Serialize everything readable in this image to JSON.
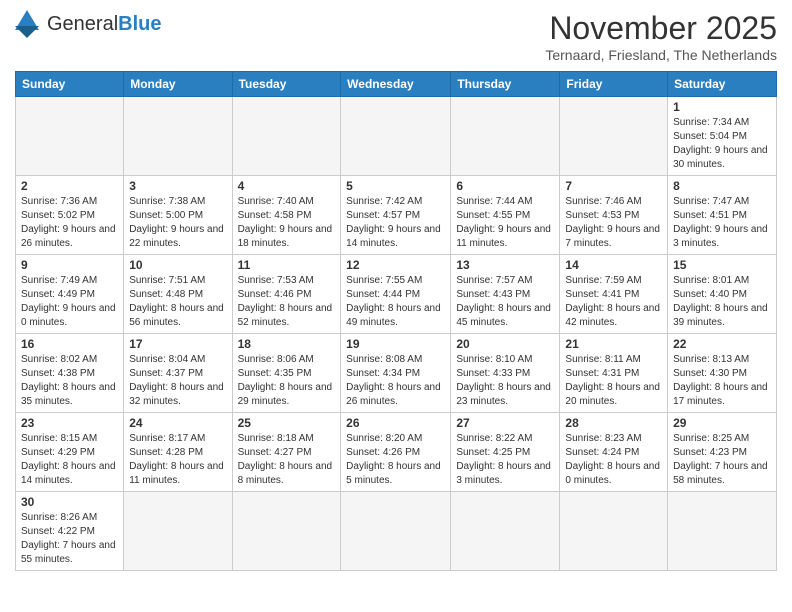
{
  "logo": {
    "text_general": "General",
    "text_blue": "Blue"
  },
  "title": "November 2025",
  "subtitle": "Ternaard, Friesland, The Netherlands",
  "weekdays": [
    "Sunday",
    "Monday",
    "Tuesday",
    "Wednesday",
    "Thursday",
    "Friday",
    "Saturday"
  ],
  "weeks": [
    [
      {
        "day": "",
        "info": ""
      },
      {
        "day": "",
        "info": ""
      },
      {
        "day": "",
        "info": ""
      },
      {
        "day": "",
        "info": ""
      },
      {
        "day": "",
        "info": ""
      },
      {
        "day": "",
        "info": ""
      },
      {
        "day": "1",
        "info": "Sunrise: 7:34 AM\nSunset: 5:04 PM\nDaylight: 9 hours and 30 minutes."
      }
    ],
    [
      {
        "day": "2",
        "info": "Sunrise: 7:36 AM\nSunset: 5:02 PM\nDaylight: 9 hours and 26 minutes."
      },
      {
        "day": "3",
        "info": "Sunrise: 7:38 AM\nSunset: 5:00 PM\nDaylight: 9 hours and 22 minutes."
      },
      {
        "day": "4",
        "info": "Sunrise: 7:40 AM\nSunset: 4:58 PM\nDaylight: 9 hours and 18 minutes."
      },
      {
        "day": "5",
        "info": "Sunrise: 7:42 AM\nSunset: 4:57 PM\nDaylight: 9 hours and 14 minutes."
      },
      {
        "day": "6",
        "info": "Sunrise: 7:44 AM\nSunset: 4:55 PM\nDaylight: 9 hours and 11 minutes."
      },
      {
        "day": "7",
        "info": "Sunrise: 7:46 AM\nSunset: 4:53 PM\nDaylight: 9 hours and 7 minutes."
      },
      {
        "day": "8",
        "info": "Sunrise: 7:47 AM\nSunset: 4:51 PM\nDaylight: 9 hours and 3 minutes."
      }
    ],
    [
      {
        "day": "9",
        "info": "Sunrise: 7:49 AM\nSunset: 4:49 PM\nDaylight: 9 hours and 0 minutes."
      },
      {
        "day": "10",
        "info": "Sunrise: 7:51 AM\nSunset: 4:48 PM\nDaylight: 8 hours and 56 minutes."
      },
      {
        "day": "11",
        "info": "Sunrise: 7:53 AM\nSunset: 4:46 PM\nDaylight: 8 hours and 52 minutes."
      },
      {
        "day": "12",
        "info": "Sunrise: 7:55 AM\nSunset: 4:44 PM\nDaylight: 8 hours and 49 minutes."
      },
      {
        "day": "13",
        "info": "Sunrise: 7:57 AM\nSunset: 4:43 PM\nDaylight: 8 hours and 45 minutes."
      },
      {
        "day": "14",
        "info": "Sunrise: 7:59 AM\nSunset: 4:41 PM\nDaylight: 8 hours and 42 minutes."
      },
      {
        "day": "15",
        "info": "Sunrise: 8:01 AM\nSunset: 4:40 PM\nDaylight: 8 hours and 39 minutes."
      }
    ],
    [
      {
        "day": "16",
        "info": "Sunrise: 8:02 AM\nSunset: 4:38 PM\nDaylight: 8 hours and 35 minutes."
      },
      {
        "day": "17",
        "info": "Sunrise: 8:04 AM\nSunset: 4:37 PM\nDaylight: 8 hours and 32 minutes."
      },
      {
        "day": "18",
        "info": "Sunrise: 8:06 AM\nSunset: 4:35 PM\nDaylight: 8 hours and 29 minutes."
      },
      {
        "day": "19",
        "info": "Sunrise: 8:08 AM\nSunset: 4:34 PM\nDaylight: 8 hours and 26 minutes."
      },
      {
        "day": "20",
        "info": "Sunrise: 8:10 AM\nSunset: 4:33 PM\nDaylight: 8 hours and 23 minutes."
      },
      {
        "day": "21",
        "info": "Sunrise: 8:11 AM\nSunset: 4:31 PM\nDaylight: 8 hours and 20 minutes."
      },
      {
        "day": "22",
        "info": "Sunrise: 8:13 AM\nSunset: 4:30 PM\nDaylight: 8 hours and 17 minutes."
      }
    ],
    [
      {
        "day": "23",
        "info": "Sunrise: 8:15 AM\nSunset: 4:29 PM\nDaylight: 8 hours and 14 minutes."
      },
      {
        "day": "24",
        "info": "Sunrise: 8:17 AM\nSunset: 4:28 PM\nDaylight: 8 hours and 11 minutes."
      },
      {
        "day": "25",
        "info": "Sunrise: 8:18 AM\nSunset: 4:27 PM\nDaylight: 8 hours and 8 minutes."
      },
      {
        "day": "26",
        "info": "Sunrise: 8:20 AM\nSunset: 4:26 PM\nDaylight: 8 hours and 5 minutes."
      },
      {
        "day": "27",
        "info": "Sunrise: 8:22 AM\nSunset: 4:25 PM\nDaylight: 8 hours and 3 minutes."
      },
      {
        "day": "28",
        "info": "Sunrise: 8:23 AM\nSunset: 4:24 PM\nDaylight: 8 hours and 0 minutes."
      },
      {
        "day": "29",
        "info": "Sunrise: 8:25 AM\nSunset: 4:23 PM\nDaylight: 7 hours and 58 minutes."
      }
    ],
    [
      {
        "day": "30",
        "info": "Sunrise: 8:26 AM\nSunset: 4:22 PM\nDaylight: 7 hours and 55 minutes."
      },
      {
        "day": "",
        "info": ""
      },
      {
        "day": "",
        "info": ""
      },
      {
        "day": "",
        "info": ""
      },
      {
        "day": "",
        "info": ""
      },
      {
        "day": "",
        "info": ""
      },
      {
        "day": "",
        "info": ""
      }
    ]
  ]
}
